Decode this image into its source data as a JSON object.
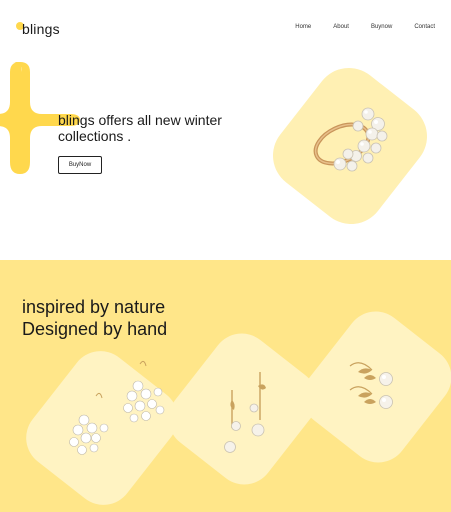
{
  "header": {
    "logo_text": "blings",
    "nav": [
      "Home",
      "About",
      "Buynow",
      "Contact"
    ]
  },
  "hero": {
    "title_line1": "blings offers all new winter",
    "title_line2": "collections .",
    "button_label": "BuyNow"
  },
  "section": {
    "title_line1": "inspired by nature",
    "title_line2": "Designed by hand"
  },
  "colors": {
    "accent": "#ffd84d",
    "accent_light": "#fff0b3",
    "section_bg": "#ffe689",
    "tile": "#fff3c2"
  },
  "icons": [
    "sparkle-icon",
    "ring-image",
    "floral-earrings-image",
    "pearl-drop-earrings-image",
    "pearl-leaf-earrings-image"
  ]
}
